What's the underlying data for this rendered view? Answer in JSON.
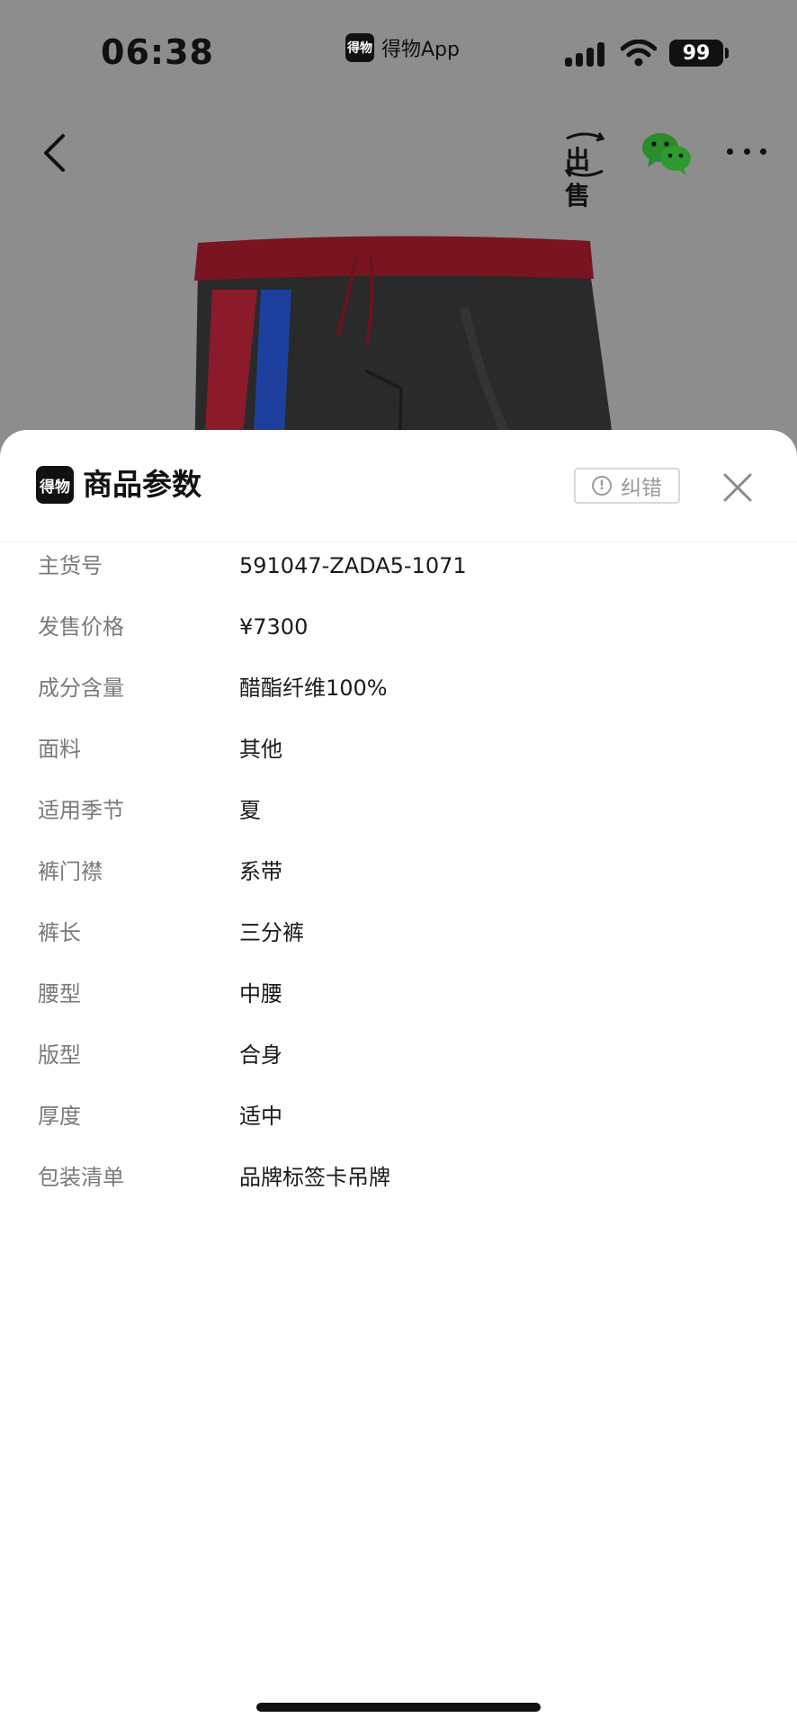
{
  "status_bar": {
    "time": "06:38",
    "app_logo_text": "得物",
    "app_name": "得物App",
    "battery": "99"
  },
  "nav": {
    "back_icon": "chevron-left-icon",
    "sell_label": "出售",
    "share_icon": "wechat-icon",
    "more_icon": "more-horizontal-icon"
  },
  "product": {
    "colors": {
      "body": "#2a2a2a",
      "waistband": "#7a1420",
      "stripe_red": "#8b1a2b",
      "stripe_blue": "#1d3f9e"
    }
  },
  "sheet": {
    "logo_text": "得物",
    "title": "商品参数",
    "report_label": "纠错",
    "report_icon": "info-circle-icon",
    "close_icon": "close-icon",
    "params": [
      {
        "label": "主货号",
        "value": "591047-ZADA5-1071"
      },
      {
        "label": "发售价格",
        "value": "¥7300"
      },
      {
        "label": "成分含量",
        "value": "醋酯纤维100%"
      },
      {
        "label": "面料",
        "value": "其他"
      },
      {
        "label": "适用季节",
        "value": "夏"
      },
      {
        "label": "裤门襟",
        "value": "系带"
      },
      {
        "label": "裤长",
        "value": "三分裤"
      },
      {
        "label": "腰型",
        "value": "中腰"
      },
      {
        "label": "版型",
        "value": "合身"
      },
      {
        "label": "厚度",
        "value": "适中"
      },
      {
        "label": "包装清单",
        "value": "品牌标签卡吊牌"
      }
    ]
  }
}
